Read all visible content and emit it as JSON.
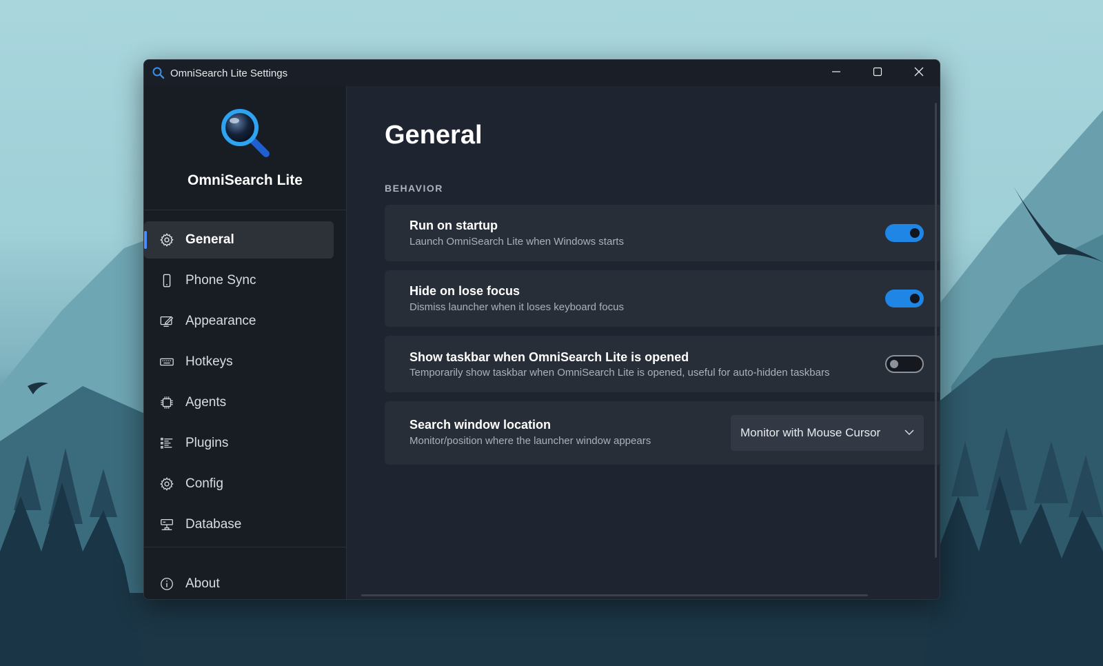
{
  "window": {
    "title": "OmniSearch Lite Settings",
    "controls": [
      "minimize-icon",
      "maximize-icon",
      "close-icon"
    ]
  },
  "sidebar": {
    "app_name": "OmniSearch Lite",
    "items": [
      {
        "label": "General",
        "icon": "gear-icon",
        "active": true
      },
      {
        "label": "Phone Sync",
        "icon": "phone-icon"
      },
      {
        "label": "Appearance",
        "icon": "appearance-icon"
      },
      {
        "label": "Hotkeys",
        "icon": "keyboard-icon"
      },
      {
        "label": "Agents",
        "icon": "chip-icon"
      },
      {
        "label": "Plugins",
        "icon": "list-icon"
      },
      {
        "label": "Config",
        "icon": "gear-icon"
      },
      {
        "label": "Database",
        "icon": "database-icon"
      }
    ],
    "footer_item": {
      "label": "About",
      "icon": "info-icon"
    }
  },
  "main": {
    "title": "General",
    "section": "BEHAVIOR",
    "settings": [
      {
        "title": "Run on startup",
        "description": "Launch OmniSearch Lite when Windows starts",
        "type": "toggle",
        "on": true
      },
      {
        "title": "Hide on lose focus",
        "description": "Dismiss launcher when it loses keyboard focus",
        "type": "toggle",
        "on": true
      },
      {
        "title": "Show taskbar when OmniSearch Lite is opened",
        "description": "Temporarily show taskbar when OmniSearch Lite is opened, useful for auto-hidden taskbars",
        "type": "toggle",
        "on": false
      },
      {
        "title": "Search window location",
        "description": "Monitor/position where the launcher window appears",
        "type": "select",
        "value": "Monitor with Mouse Cursor"
      }
    ]
  },
  "colors": {
    "accent": "#1f86e6",
    "nav_indicator": "#4c8dff",
    "window_bg": "#1e2530",
    "card_bg": "#272e38"
  }
}
